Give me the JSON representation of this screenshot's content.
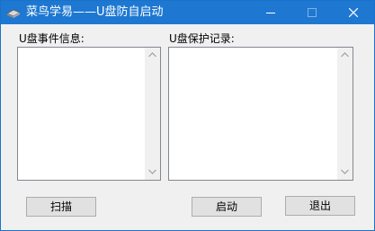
{
  "window": {
    "title": "菜鸟学易——U盘防自启动",
    "titlebar_color": "#1e78d2"
  },
  "titlebar_buttons": {
    "minimize_icon": "minimize-icon",
    "maximize_icon": "maximize-icon",
    "close_icon": "close-icon"
  },
  "left_panel": {
    "label": "U盘事件信息:"
  },
  "right_panel": {
    "label": "U盘保护记录:"
  },
  "buttons": {
    "scan": "扫描",
    "start": "启动",
    "exit": "退出"
  }
}
